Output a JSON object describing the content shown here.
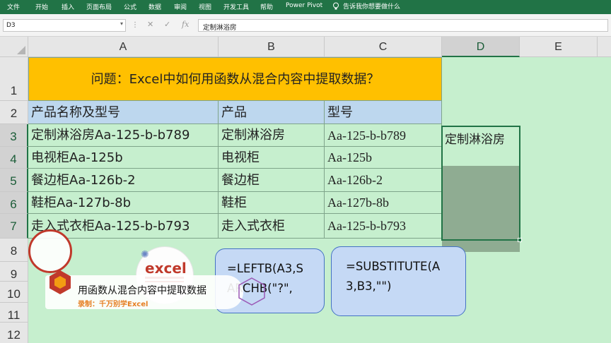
{
  "ribbon": {
    "tabs": [
      "文件",
      "开始",
      "插入",
      "页面布局",
      "公式",
      "数据",
      "审阅",
      "视图",
      "开发工具",
      "帮助",
      "Power Pivot"
    ],
    "tell_me": "告诉我你想要做什么"
  },
  "formula_bar": {
    "name_box": "D3",
    "formula": "定制淋浴房"
  },
  "columns": [
    "A",
    "B",
    "C",
    "D",
    "E"
  ],
  "rows": [
    "1",
    "2",
    "3",
    "4",
    "5",
    "6",
    "7",
    "8",
    "9",
    "10",
    "11",
    "12"
  ],
  "sheet": {
    "title": "问题：Excel中如何用函数从混合内容中提取数据？",
    "headers": [
      "产品名称及型号",
      "产品",
      "型号"
    ],
    "data": [
      [
        "定制淋浴房Aa-125-b-b789",
        "定制淋浴房",
        "Aa-125-b-b789"
      ],
      [
        "电视柜Aa-125b",
        "电视柜",
        "Aa-125b"
      ],
      [
        "餐边柜Aa-126b-2",
        "餐边柜",
        "Aa-126b-2"
      ],
      [
        "鞋柜Aa-127b-8b",
        "鞋柜",
        "Aa-127b-8b"
      ],
      [
        "走入式衣柜Aa-125-b-b793",
        "走入式衣柜",
        "Aa-125-b-b793"
      ]
    ],
    "d3": "定制淋浴房"
  },
  "overlays": {
    "formula1_line1": "=LEFTB(A3,S",
    "formula1_line2": "ARCHB(\"?\",",
    "formula2_line1": "=SUBSTITUTE(A",
    "formula2_line2": "3,B3,\"\")",
    "banner_title": "用函数从混合内容中提取数据",
    "banner_sub": "录制：千万别学Excel",
    "logo_text": "excel"
  },
  "colors": {
    "ribbon": "#217346",
    "title_fill": "#ffc000",
    "header_fill": "#bdd7ee",
    "sheet_fill": "#c6efce",
    "bubble_fill": "#c5d9f5"
  }
}
